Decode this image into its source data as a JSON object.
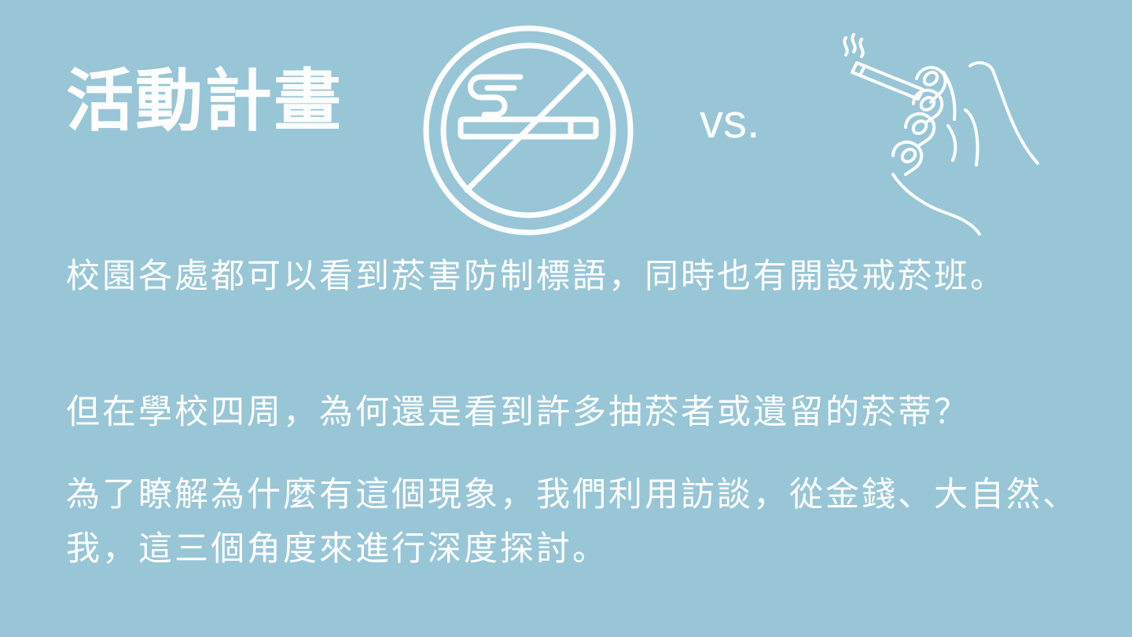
{
  "slide": {
    "title": "活動計畫",
    "vs_label": "vs.",
    "paragraphs": [
      "校園各處都可以看到菸害防制標語，同時也有開設戒菸班。",
      "但在學校四周，為何還是看到許多抽菸者或遺留的菸蒂？",
      "為了瞭解為什麼有這個現象，我們利用訪談，從金錢、大自然、我，這三個角度來進行深度探討。"
    ],
    "icons": {
      "left": "no-smoking-icon",
      "right": "hand-holding-cigarette-icon"
    },
    "colors": {
      "background": "#98c6d7",
      "foreground": "#ffffff"
    }
  }
}
